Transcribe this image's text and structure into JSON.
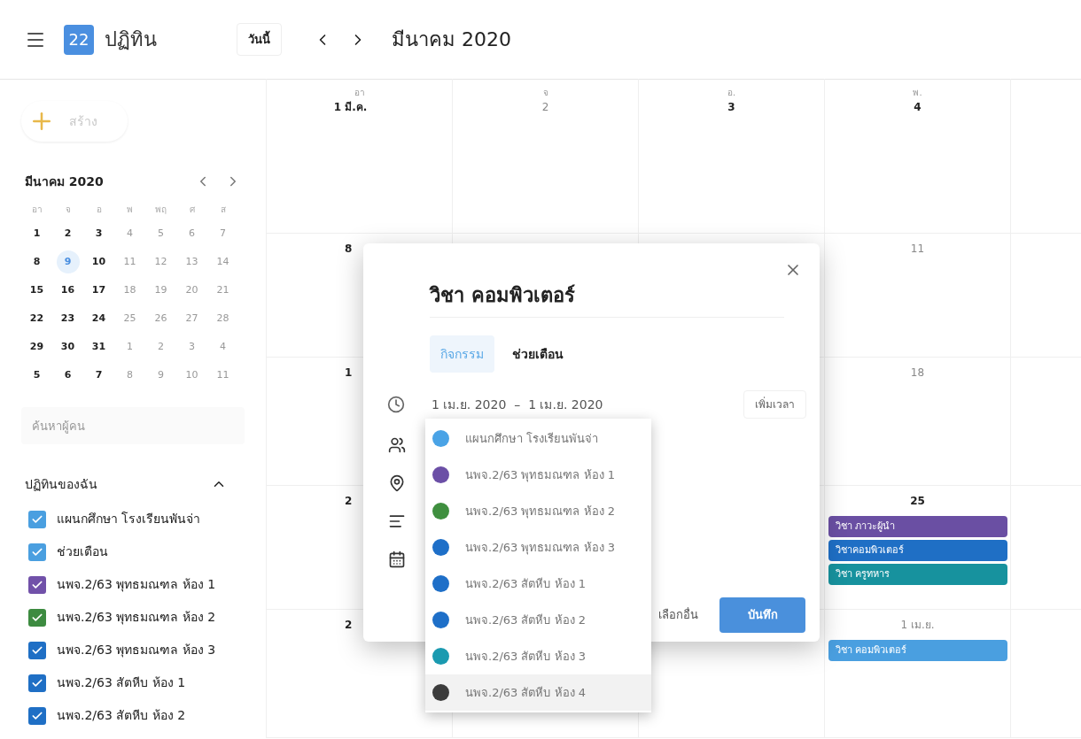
{
  "header": {
    "logo_text": "22",
    "title": "ปฏิทิน",
    "today_button": "วันนี้",
    "period": "มีนาคม 2020"
  },
  "sidebar": {
    "create_button": "สร้าง",
    "mini_calendar": {
      "title": "มีนาคม 2020",
      "weekdays": [
        "อา",
        "จ",
        "อ",
        "พ",
        "พฤ",
        "ศ",
        "ส"
      ],
      "weeks": [
        [
          {
            "day": "1",
            "dim": false,
            "selected": false
          },
          {
            "day": "2",
            "dim": false,
            "selected": false
          },
          {
            "day": "3",
            "dim": false,
            "selected": false
          },
          {
            "day": "4",
            "dim": true,
            "selected": false
          },
          {
            "day": "5",
            "dim": true,
            "selected": false
          },
          {
            "day": "6",
            "dim": true,
            "selected": false
          },
          {
            "day": "7",
            "dim": true,
            "selected": false
          }
        ],
        [
          {
            "day": "8",
            "dim": false,
            "selected": false
          },
          {
            "day": "9",
            "dim": false,
            "selected": true
          },
          {
            "day": "10",
            "dim": false,
            "selected": false
          },
          {
            "day": "11",
            "dim": true,
            "selected": false
          },
          {
            "day": "12",
            "dim": true,
            "selected": false
          },
          {
            "day": "13",
            "dim": true,
            "selected": false
          },
          {
            "day": "14",
            "dim": true,
            "selected": false
          }
        ],
        [
          {
            "day": "15",
            "dim": false,
            "selected": false
          },
          {
            "day": "16",
            "dim": false,
            "selected": false
          },
          {
            "day": "17",
            "dim": false,
            "selected": false
          },
          {
            "day": "18",
            "dim": true,
            "selected": false
          },
          {
            "day": "19",
            "dim": true,
            "selected": false
          },
          {
            "day": "20",
            "dim": true,
            "selected": false
          },
          {
            "day": "21",
            "dim": true,
            "selected": false
          }
        ],
        [
          {
            "day": "22",
            "dim": false,
            "selected": false
          },
          {
            "day": "23",
            "dim": false,
            "selected": false
          },
          {
            "day": "24",
            "dim": false,
            "selected": false
          },
          {
            "day": "25",
            "dim": true,
            "selected": false
          },
          {
            "day": "26",
            "dim": true,
            "selected": false
          },
          {
            "day": "27",
            "dim": true,
            "selected": false
          },
          {
            "day": "28",
            "dim": true,
            "selected": false
          }
        ],
        [
          {
            "day": "29",
            "dim": false,
            "selected": false
          },
          {
            "day": "30",
            "dim": false,
            "selected": false
          },
          {
            "day": "31",
            "dim": false,
            "selected": false
          },
          {
            "day": "1",
            "dim": true,
            "selected": false
          },
          {
            "day": "2",
            "dim": true,
            "selected": false
          },
          {
            "day": "3",
            "dim": true,
            "selected": false
          },
          {
            "day": "4",
            "dim": true,
            "selected": false
          }
        ],
        [
          {
            "day": "5",
            "dim": false,
            "selected": false
          },
          {
            "day": "6",
            "dim": false,
            "selected": false
          },
          {
            "day": "7",
            "dim": false,
            "selected": false
          },
          {
            "day": "8",
            "dim": true,
            "selected": false
          },
          {
            "day": "9",
            "dim": true,
            "selected": false
          },
          {
            "day": "10",
            "dim": true,
            "selected": false
          },
          {
            "day": "11",
            "dim": true,
            "selected": false
          }
        ]
      ]
    },
    "search": {
      "placeholder": "ค้นหาผู้คน"
    },
    "my_calendars": {
      "title": "ปฏิทินของฉัน",
      "expanded": true,
      "items": [
        {
          "label": "แผนกศึกษา โรงเรียนพันจ่า",
          "checked": true,
          "color": "#4a9fe0"
        },
        {
          "label": "ช่วยเตือน",
          "checked": true,
          "color": "#4a9fe0"
        },
        {
          "label": "นพจ.2/63 พุทธมณฑล ห้อง 1",
          "checked": true,
          "color": "#7151a9"
        },
        {
          "label": "นพจ.2/63 พุทธมณฑล ห้อง 2",
          "checked": true,
          "color": "#3d8b40"
        },
        {
          "label": "นพจ.2/63 พุทธมณฑล ห้อง 3",
          "checked": true,
          "color": "#1f6fc5"
        },
        {
          "label": "นพจ.2/63 สัตหีบ ห้อง 1",
          "checked": true,
          "color": "#1f6fc5"
        },
        {
          "label": "นพจ.2/63 สัตหีบ ห้อง 2",
          "checked": true,
          "color": "#1f6fc5"
        }
      ]
    }
  },
  "month_grid": {
    "weekday_headers": [
      "อา",
      "จ",
      "อ.",
      "พ."
    ],
    "weeks": [
      {
        "sun": {
          "date": "1 มี.ค.",
          "dim": false
        },
        "mon": {
          "date": "2",
          "dim": true
        },
        "tue": {
          "date": "3",
          "dim": false
        },
        "wed": {
          "date": "4",
          "dim": false
        }
      },
      {
        "sun": {
          "date": "8",
          "dim": false
        },
        "wed": {
          "date": "11",
          "dim": true
        }
      },
      {
        "sun": {
          "date": "1",
          "dim": false
        },
        "wed": {
          "date": "18",
          "dim": true
        }
      },
      {
        "sun": {
          "date": "2",
          "dim": false
        },
        "wed": {
          "date": "25",
          "dim": false,
          "events": [
            {
              "label": "วิชา ภาวะผู้นำ",
              "color": "#6a4fa3"
            },
            {
              "label": "วิชาคอมพิวเตอร์",
              "color": "#1f6fc5"
            },
            {
              "label": "วิชา ครูทหาร",
              "color": "#17929e"
            }
          ]
        }
      },
      {
        "sun": {
          "date": "2",
          "dim": false
        },
        "wed": {
          "date": "1 เม.ย.",
          "dim": true,
          "events": [
            {
              "label": "วิชา คอมพิวเตอร์",
              "color": "#4a9fe0"
            }
          ]
        }
      }
    ]
  },
  "event_dialog": {
    "title": "วิชา คอมพิวเตอร์",
    "tabs": [
      {
        "label": "กิจกรรม",
        "selected": true
      },
      {
        "label": "ช่วยเตือน",
        "selected": false
      }
    ],
    "date_range": "1 เม.ย. 2020  –  1 เม.ย. 2020",
    "add_time_button": "เพิ่มเวลา",
    "more_options_button": "เลือกอื่น",
    "save_button": "บันทึก"
  },
  "calendar_dropdown": {
    "items": [
      {
        "label": "แผนกศึกษา โรงเรียนพันจ่า",
        "color": "#4aa3e6",
        "selected": false
      },
      {
        "label": "นพจ.2/63 พุทธมณฑล ห้อง 1",
        "color": "#6b4fa6",
        "selected": false
      },
      {
        "label": "นพจ.2/63 พุทธมณฑล ห้อง 2",
        "color": "#3f8f3f",
        "selected": false
      },
      {
        "label": "นพจ.2/63 พุทธมณฑล ห้อง 3",
        "color": "#1e6fc8",
        "selected": false
      },
      {
        "label": "นพจ.2/63 สัตหีบ ห้อง 1",
        "color": "#1e6fc8",
        "selected": false
      },
      {
        "label": "นพจ.2/63 สัตหีบ ห้อง 2",
        "color": "#1e6fc8",
        "selected": false
      },
      {
        "label": "นพจ.2/63 สัตหีบ ห้อง 3",
        "color": "#1a9ab0",
        "selected": false
      },
      {
        "label": "นพจ.2/63 สัตหีบ ห้อง 4",
        "color": "#3c3c3c",
        "selected": true
      }
    ]
  }
}
